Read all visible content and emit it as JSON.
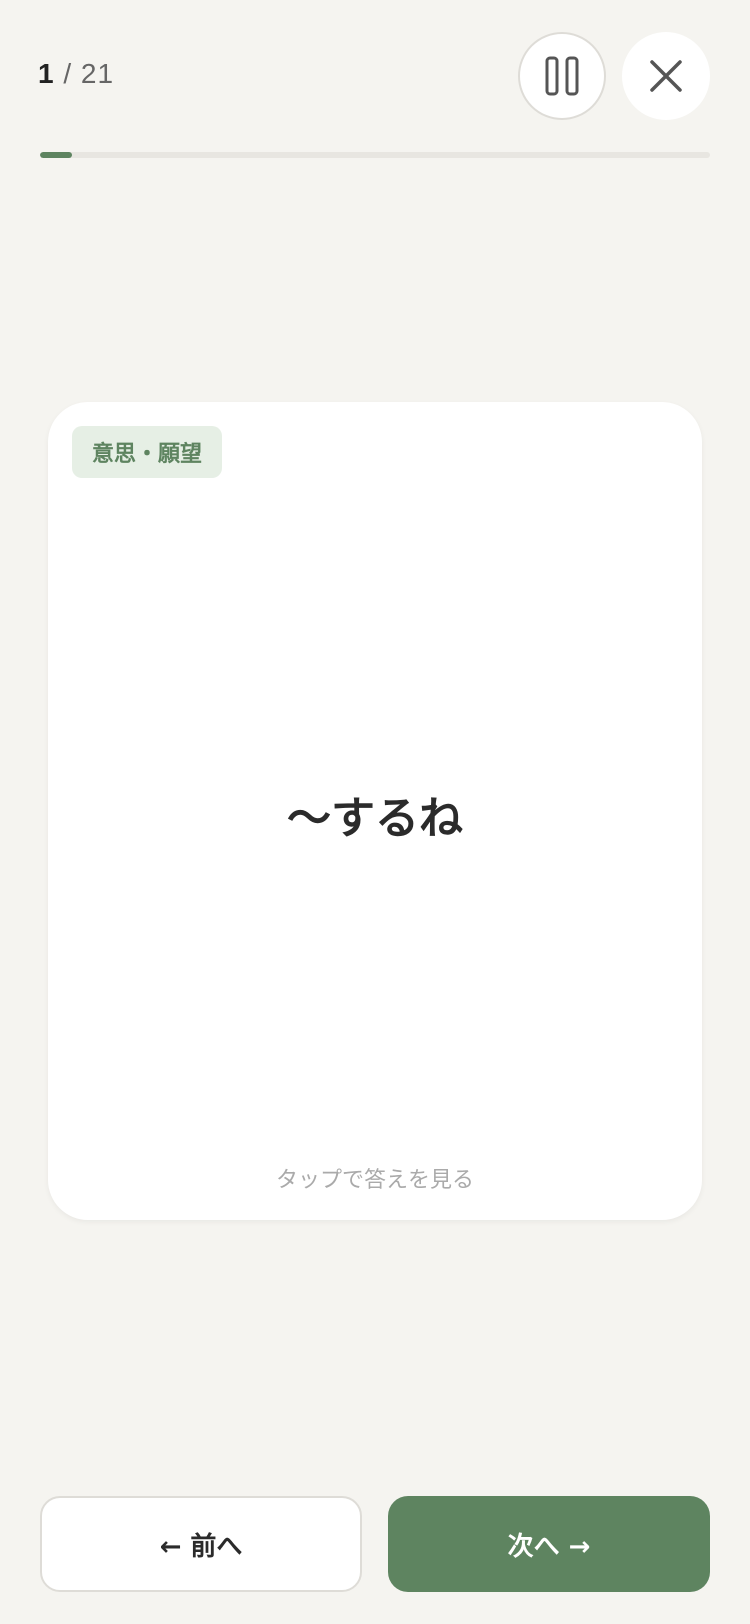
{
  "header": {
    "current": "1",
    "separator": "/",
    "total": "21"
  },
  "progress": {
    "fraction": 0.0476
  },
  "controls": {
    "pause_icon": "pause-icon",
    "close_icon": "close-icon"
  },
  "card": {
    "category": "意思・願望",
    "term": "〜するね",
    "hint": "タップで答えを見る"
  },
  "nav": {
    "prev_label": "← 前へ",
    "next_label": "次へ →"
  },
  "colors": {
    "accent": "#5e8460",
    "background": "#f5f4f0",
    "badge_bg": "#e6efe5"
  }
}
